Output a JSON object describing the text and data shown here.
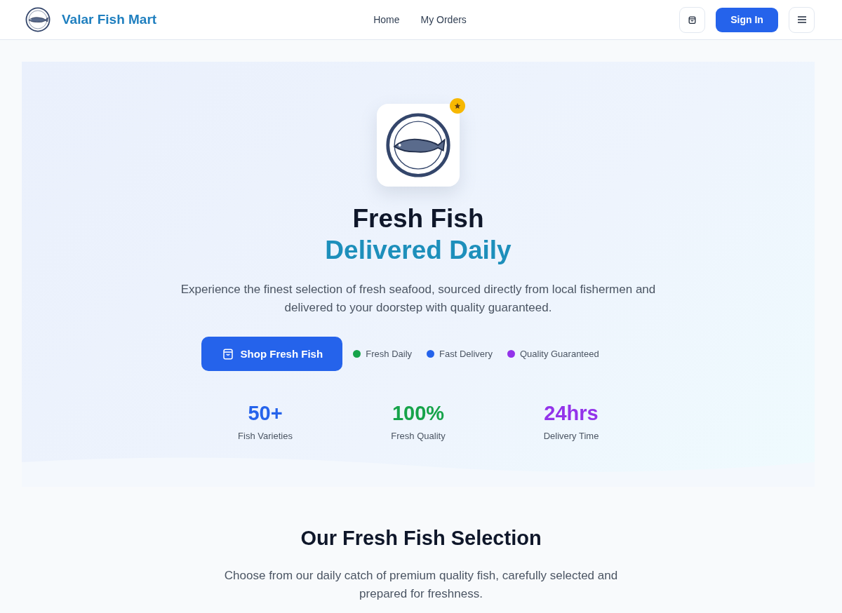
{
  "header": {
    "brand": "Valar Fish Mart",
    "nav": [
      {
        "label": "Home"
      },
      {
        "label": "My Orders"
      }
    ],
    "sign_in": "Sign In"
  },
  "hero": {
    "title": "Fresh Fish",
    "subtitle": "Delivered Daily",
    "description": "Experience the finest selection of fresh seafood, sourced directly from local fishermen and delivered to your doorstep with quality guaranteed.",
    "cta": "Shop Fresh Fish",
    "features": [
      {
        "label": "Fresh Daily",
        "color": "#16a34a"
      },
      {
        "label": "Fast Delivery",
        "color": "#2563eb"
      },
      {
        "label": "Quality Guaranteed",
        "color": "#9333ea"
      }
    ],
    "stats": [
      {
        "value": "50+",
        "label": "Fish Varieties",
        "color": "#2563eb"
      },
      {
        "value": "100%",
        "label": "Fresh Quality",
        "color": "#16a34a"
      },
      {
        "value": "24hrs",
        "label": "Delivery Time",
        "color": "#9333ea"
      }
    ]
  },
  "selection": {
    "title": "Our Fresh Fish Selection",
    "description": "Choose from our daily catch of premium quality fish, carefully selected and prepared for freshness."
  }
}
